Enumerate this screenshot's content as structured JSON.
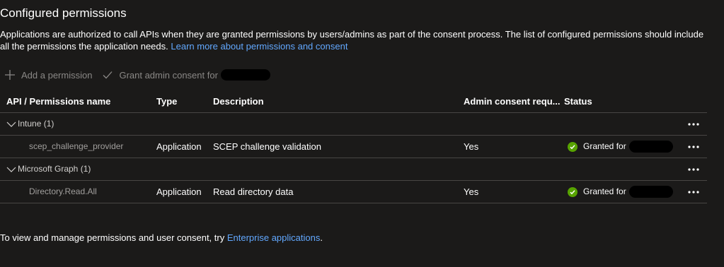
{
  "section": {
    "title": "Configured permissions",
    "description": "Applications are authorized to call APIs when they are granted permissions by users/admins as part of the consent process. The list of configured permissions should include all the permissions the application needs.",
    "learn_more_link": "Learn more about permissions and consent"
  },
  "toolbar": {
    "add_permission": "Add a permission",
    "grant_consent": "Grant admin consent for"
  },
  "table": {
    "headers": {
      "name": "API / Permissions name",
      "type": "Type",
      "description": "Description",
      "admin": "Admin consent requ...",
      "status": "Status"
    },
    "groups": [
      {
        "label": "Intune (1)",
        "rows": [
          {
            "name": "scep_challenge_provider",
            "type": "Application",
            "description": "SCEP challenge validation",
            "admin": "Yes",
            "status": "Granted for"
          }
        ]
      },
      {
        "label": "Microsoft Graph (1)",
        "rows": [
          {
            "name": "Directory.Read.All",
            "type": "Application",
            "description": "Read directory data",
            "admin": "Yes",
            "status": "Granted for"
          }
        ]
      }
    ]
  },
  "footer": {
    "text": "To view and manage permissions and user consent, try ",
    "link": "Enterprise applications",
    "suffix": "."
  },
  "colors": {
    "background": "#1b1a19",
    "link": "#62a8ff",
    "granted": "#57a300",
    "muted": "#8a8886"
  },
  "icons": [
    "plus-icon",
    "checkmark-icon",
    "chevron-down-icon",
    "more-icon",
    "success-check-icon"
  ]
}
